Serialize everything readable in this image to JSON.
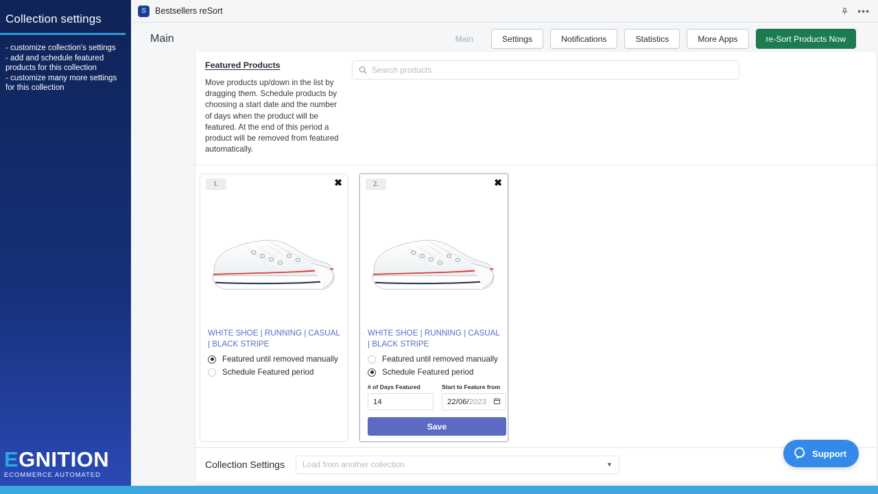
{
  "sidebar": {
    "title": "Collection settings",
    "description": "- customize collection's settings\n- add and schedule featured products for this collection\n- customize many more settings for this collection",
    "logo_main_accent": "E",
    "logo_main_rest": "GNITION",
    "logo_sub": "ECOMMERCE AUTOMATED",
    "accent_color": "#2d9cdb"
  },
  "topbar": {
    "app_icon": "shopify-s-icon",
    "app_title": "Bestsellers reSort",
    "pin_icon": "pin-icon",
    "menu_icon": "more-dots-icon"
  },
  "header": {
    "page_title": "Main",
    "tabs": [
      {
        "label": "Main",
        "state": "disabled"
      },
      {
        "label": "Settings",
        "state": "default"
      },
      {
        "label": "Notifications",
        "state": "default"
      },
      {
        "label": "Statistics",
        "state": "default"
      },
      {
        "label": "More Apps",
        "state": "default"
      }
    ],
    "primary_button": "re-Sort Products Now",
    "primary_color": "#1d7b52"
  },
  "featured": {
    "heading": "Featured Products",
    "description": "Move products up/down in the list by dragging them. Schedule products by choosing a start date and the number of days when the product will be featured. At the end of this period a product will be removed from featured automatically.",
    "search_placeholder": "Search products",
    "search_value": "",
    "search_icon": "search-icon"
  },
  "products": [
    {
      "order": "1.",
      "name": "WHITE SHOE | RUNNING | CASUAL | BLACK STRIPE",
      "remove_icon": "close-icon",
      "image": "white-sneaker",
      "options": [
        {
          "label": "Featured until removed manually",
          "selected": true
        },
        {
          "label": "Schedule Featured period",
          "selected": false
        }
      ],
      "show_schedule_fields": false,
      "selected_card": false
    },
    {
      "order": "2.",
      "name": "WHITE SHOE | RUNNING | CASUAL | BLACK STRIPE",
      "remove_icon": "close-icon",
      "image": "white-sneaker",
      "options": [
        {
          "label": "Featured until removed manually",
          "selected": false
        },
        {
          "label": "Schedule Featured period",
          "selected": true
        }
      ],
      "show_schedule_fields": true,
      "selected_card": true,
      "days_label": "# of Days Featured",
      "days_value": "14",
      "date_label": "Start to Feature from",
      "date_day": "22",
      "date_month": "06",
      "date_year": "2023",
      "date_separator": "/",
      "calendar_icon": "calendar-icon",
      "save_label": "Save",
      "save_color": "#5c6ac4"
    }
  ],
  "collection_settings": {
    "label": "Collection Settings",
    "select_placeholder": "Load from another collection",
    "caret_icon": "chevron-down-icon"
  },
  "support": {
    "label": "Support",
    "icon": "chat-bubble-icon",
    "color": "#338ae8"
  }
}
